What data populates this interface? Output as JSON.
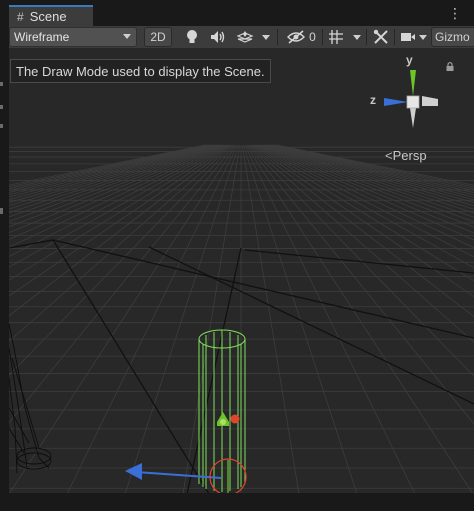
{
  "tab": {
    "title": "Scene",
    "icon": "grid-icon"
  },
  "menu": {
    "icon": "more-vertical-icon"
  },
  "toolbar": {
    "draw_mode": "Wireframe",
    "toggle_2d": "2D",
    "lighting_icon": "lightbulb-icon",
    "audio_icon": "speaker-icon",
    "effects_icon": "effects-icon",
    "hidden_count": "0",
    "hidden_icon": "eye-slash-icon",
    "grid_icon": "grid-snap-icon",
    "tools_icon": "tools-icon",
    "camera_icon": "camera-icon",
    "gizmos": "Gizmo"
  },
  "tooltip": {
    "text": "The Draw Mode used to display the Scene."
  },
  "gizmo": {
    "y_label": "y",
    "z_label": "z",
    "projection": "Persp"
  },
  "colors": {
    "tab_accent": "#3a79bb",
    "axis_y": "#6ec32a",
    "axis_x": "#e0442c",
    "axis_z": "#3b6fd8",
    "wire_green": "#7ee05a"
  }
}
